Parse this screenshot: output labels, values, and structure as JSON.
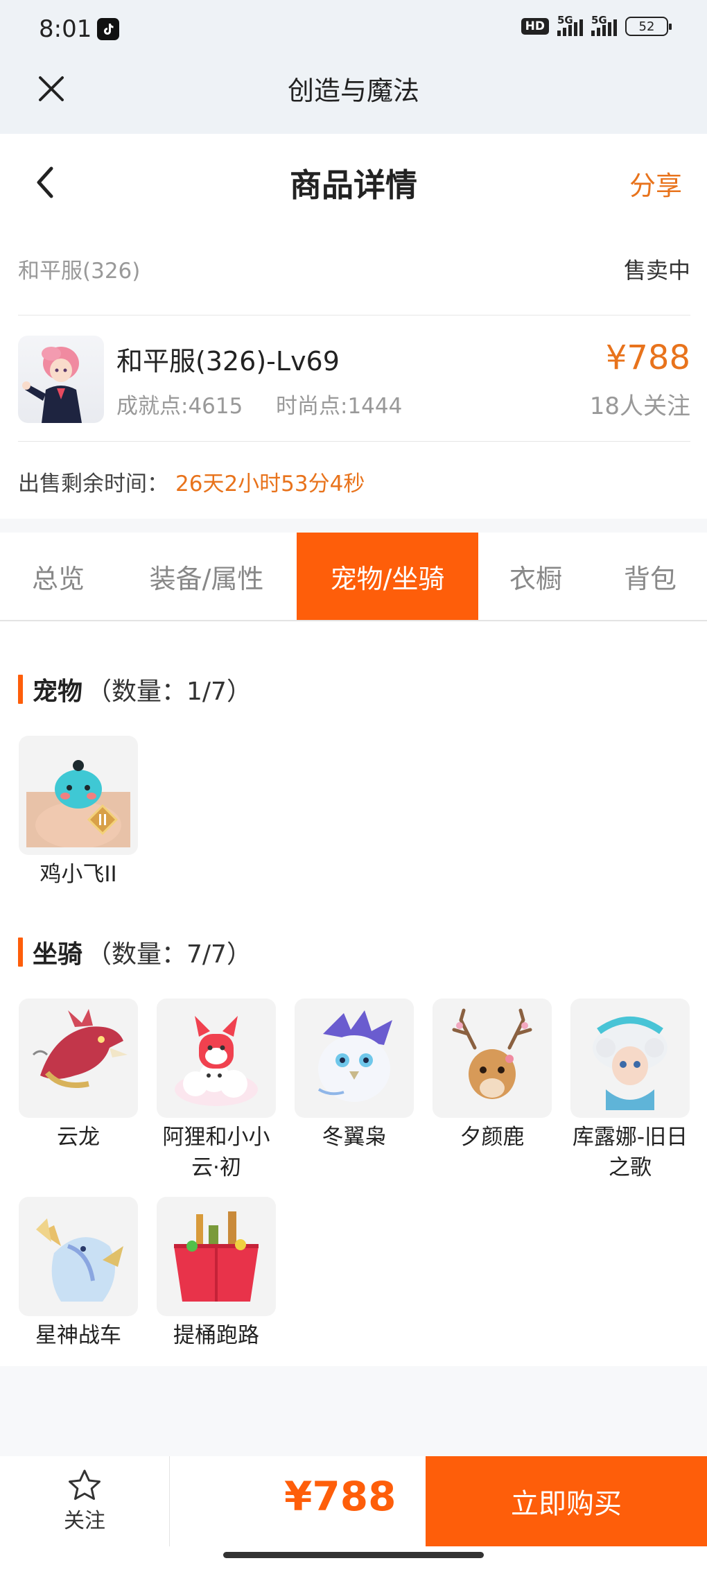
{
  "status_bar": {
    "time": "8:01",
    "hd_label": "HD",
    "network_1": "5G",
    "network_2": "5G",
    "battery": "52"
  },
  "app": {
    "title": "创造与魔法",
    "close_icon": "close-icon"
  },
  "header": {
    "title": "商品详情",
    "share": "分享",
    "back_icon": "chevron-left-icon"
  },
  "listing": {
    "server": "和平服(326)",
    "status": "售卖中",
    "name": "和平服(326)-Lv69",
    "achievement": "成就点:4615",
    "fashion": "时尚点:1444",
    "price": "¥788",
    "followers": "18人关注",
    "remain_label": "出售剩余时间：",
    "remain_value": "26天2小时53分4秒"
  },
  "tabs": [
    {
      "label": "总览",
      "active": false
    },
    {
      "label": "装备/属性",
      "active": false
    },
    {
      "label": "宠物/坐骑",
      "active": true
    },
    {
      "label": "衣橱",
      "active": false
    },
    {
      "label": "背包",
      "active": false
    }
  ],
  "pets": {
    "title": "宠物",
    "count": "（数量：1/7）",
    "items": [
      {
        "name": "鸡小飞II"
      }
    ]
  },
  "mounts": {
    "title": "坐骑",
    "count": "（数量：7/7）",
    "items": [
      {
        "name": "云龙"
      },
      {
        "name": "阿狸和小小云·初"
      },
      {
        "name": "冬翼枭"
      },
      {
        "name": "夕颜鹿"
      },
      {
        "name": "库露娜-旧日之歌"
      },
      {
        "name": "星神战车"
      },
      {
        "name": "提桶跑路"
      }
    ]
  },
  "bottom_bar": {
    "follow_label": "关注",
    "price": "¥788",
    "buy_label": "立即购买"
  },
  "colors": {
    "accent": "#fe5e0a",
    "price_text": "#e8731c",
    "muted_text": "#999999"
  }
}
